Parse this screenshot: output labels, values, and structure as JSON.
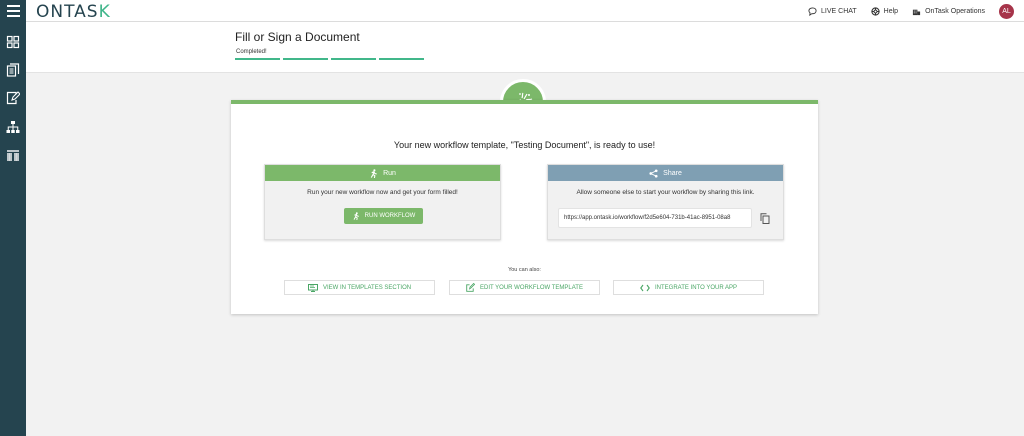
{
  "app": {
    "logo_text": "ONTAS",
    "logo_accent": "K",
    "brand_color": "#25444f",
    "accent_color": "#7cb86a"
  },
  "topbar": {
    "live_chat": "LIVE CHAT",
    "help": "Help",
    "org": "OnTask Operations",
    "avatar_initials": "AL"
  },
  "sidebar": {
    "items": [
      {
        "icon": "dashboard-icon"
      },
      {
        "icon": "documents-icon"
      },
      {
        "icon": "sign-document-icon"
      },
      {
        "icon": "workflow-tree-icon"
      },
      {
        "icon": "columns-icon"
      }
    ]
  },
  "header": {
    "title": "Fill or Sign a Document",
    "status": "Completed!",
    "progress_steps_completed": 4,
    "progress_steps_total": 4
  },
  "card": {
    "heading": "Your new workflow template, \"Testing Document\", is ready to use!",
    "run": {
      "title": "Run",
      "text": "Run your new workflow now and get your form filled!",
      "button": "RUN WORKFLOW"
    },
    "share": {
      "title": "Share",
      "text": "Allow someone else to start your workflow by sharing this link.",
      "link": "https://app.ontask.io/workflow/f2d5e604-731b-41ac-8951-08a8"
    },
    "also_label": "You can also:",
    "actions": [
      {
        "label": "VIEW IN TEMPLATES SECTION"
      },
      {
        "label": "EDIT YOUR WORKFLOW TEMPLATE"
      },
      {
        "label": "INTEGRATE INTO YOUR APP"
      }
    ]
  }
}
